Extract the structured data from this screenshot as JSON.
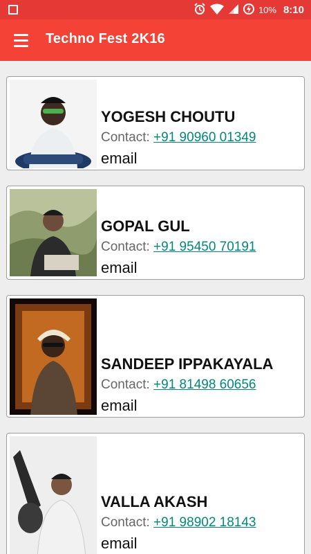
{
  "status_bar": {
    "battery": "10%",
    "time": "8:10"
  },
  "app_bar": {
    "title": "Techno Fest 2K16"
  },
  "contacts": [
    {
      "name": "YOGESH CHOUTU",
      "contact_label": "Contact: ",
      "phone": "+91 90960 01349",
      "email_label": "email"
    },
    {
      "name": "GOPAL GUL",
      "contact_label": "Contact: ",
      "phone": "+91 95450 70191",
      "email_label": "email"
    },
    {
      "name": "SANDEEP IPPAKAYALA",
      "contact_label": "Contact: ",
      "phone": "+91 81498 60656",
      "email_label": "email"
    },
    {
      "name": "VALLA AKASH",
      "contact_label": "Contact: ",
      "phone": "+91 98902 18143",
      "email_label": "email"
    }
  ],
  "colors": {
    "primary": "#f44336",
    "status_bar": "#e53935",
    "link": "#00897b"
  },
  "icons": [
    "notification-square-icon",
    "alarm-icon",
    "wifi-icon",
    "signal-icon",
    "battery-charging-icon",
    "menu-icon",
    "person-photo"
  ]
}
